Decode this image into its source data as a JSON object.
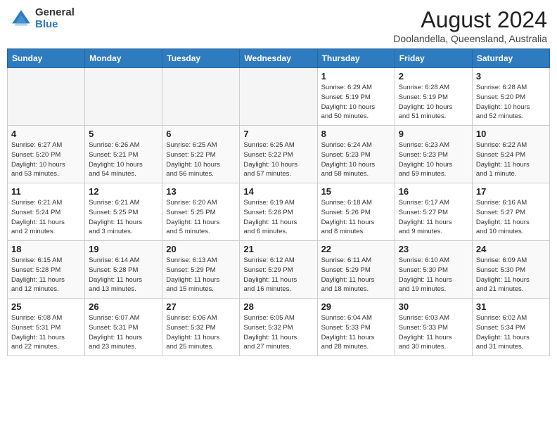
{
  "header": {
    "logo_general": "General",
    "logo_blue": "Blue",
    "month_title": "August 2024",
    "location": "Doolandella, Queensland, Australia"
  },
  "weekdays": [
    "Sunday",
    "Monday",
    "Tuesday",
    "Wednesday",
    "Thursday",
    "Friday",
    "Saturday"
  ],
  "weeks": [
    [
      {
        "day": "",
        "info": ""
      },
      {
        "day": "",
        "info": ""
      },
      {
        "day": "",
        "info": ""
      },
      {
        "day": "",
        "info": ""
      },
      {
        "day": "1",
        "info": "Sunrise: 6:29 AM\nSunset: 5:19 PM\nDaylight: 10 hours\nand 50 minutes."
      },
      {
        "day": "2",
        "info": "Sunrise: 6:28 AM\nSunset: 5:19 PM\nDaylight: 10 hours\nand 51 minutes."
      },
      {
        "day": "3",
        "info": "Sunrise: 6:28 AM\nSunset: 5:20 PM\nDaylight: 10 hours\nand 52 minutes."
      }
    ],
    [
      {
        "day": "4",
        "info": "Sunrise: 6:27 AM\nSunset: 5:20 PM\nDaylight: 10 hours\nand 53 minutes."
      },
      {
        "day": "5",
        "info": "Sunrise: 6:26 AM\nSunset: 5:21 PM\nDaylight: 10 hours\nand 54 minutes."
      },
      {
        "day": "6",
        "info": "Sunrise: 6:25 AM\nSunset: 5:22 PM\nDaylight: 10 hours\nand 56 minutes."
      },
      {
        "day": "7",
        "info": "Sunrise: 6:25 AM\nSunset: 5:22 PM\nDaylight: 10 hours\nand 57 minutes."
      },
      {
        "day": "8",
        "info": "Sunrise: 6:24 AM\nSunset: 5:23 PM\nDaylight: 10 hours\nand 58 minutes."
      },
      {
        "day": "9",
        "info": "Sunrise: 6:23 AM\nSunset: 5:23 PM\nDaylight: 10 hours\nand 59 minutes."
      },
      {
        "day": "10",
        "info": "Sunrise: 6:22 AM\nSunset: 5:24 PM\nDaylight: 11 hours\nand 1 minute."
      }
    ],
    [
      {
        "day": "11",
        "info": "Sunrise: 6:21 AM\nSunset: 5:24 PM\nDaylight: 11 hours\nand 2 minutes."
      },
      {
        "day": "12",
        "info": "Sunrise: 6:21 AM\nSunset: 5:25 PM\nDaylight: 11 hours\nand 3 minutes."
      },
      {
        "day": "13",
        "info": "Sunrise: 6:20 AM\nSunset: 5:25 PM\nDaylight: 11 hours\nand 5 minutes."
      },
      {
        "day": "14",
        "info": "Sunrise: 6:19 AM\nSunset: 5:26 PM\nDaylight: 11 hours\nand 6 minutes."
      },
      {
        "day": "15",
        "info": "Sunrise: 6:18 AM\nSunset: 5:26 PM\nDaylight: 11 hours\nand 8 minutes."
      },
      {
        "day": "16",
        "info": "Sunrise: 6:17 AM\nSunset: 5:27 PM\nDaylight: 11 hours\nand 9 minutes."
      },
      {
        "day": "17",
        "info": "Sunrise: 6:16 AM\nSunset: 5:27 PM\nDaylight: 11 hours\nand 10 minutes."
      }
    ],
    [
      {
        "day": "18",
        "info": "Sunrise: 6:15 AM\nSunset: 5:28 PM\nDaylight: 11 hours\nand 12 minutes."
      },
      {
        "day": "19",
        "info": "Sunrise: 6:14 AM\nSunset: 5:28 PM\nDaylight: 11 hours\nand 13 minutes."
      },
      {
        "day": "20",
        "info": "Sunrise: 6:13 AM\nSunset: 5:29 PM\nDaylight: 11 hours\nand 15 minutes."
      },
      {
        "day": "21",
        "info": "Sunrise: 6:12 AM\nSunset: 5:29 PM\nDaylight: 11 hours\nand 16 minutes."
      },
      {
        "day": "22",
        "info": "Sunrise: 6:11 AM\nSunset: 5:29 PM\nDaylight: 11 hours\nand 18 minutes."
      },
      {
        "day": "23",
        "info": "Sunrise: 6:10 AM\nSunset: 5:30 PM\nDaylight: 11 hours\nand 19 minutes."
      },
      {
        "day": "24",
        "info": "Sunrise: 6:09 AM\nSunset: 5:30 PM\nDaylight: 11 hours\nand 21 minutes."
      }
    ],
    [
      {
        "day": "25",
        "info": "Sunrise: 6:08 AM\nSunset: 5:31 PM\nDaylight: 11 hours\nand 22 minutes."
      },
      {
        "day": "26",
        "info": "Sunrise: 6:07 AM\nSunset: 5:31 PM\nDaylight: 11 hours\nand 23 minutes."
      },
      {
        "day": "27",
        "info": "Sunrise: 6:06 AM\nSunset: 5:32 PM\nDaylight: 11 hours\nand 25 minutes."
      },
      {
        "day": "28",
        "info": "Sunrise: 6:05 AM\nSunset: 5:32 PM\nDaylight: 11 hours\nand 27 minutes."
      },
      {
        "day": "29",
        "info": "Sunrise: 6:04 AM\nSunset: 5:33 PM\nDaylight: 11 hours\nand 28 minutes."
      },
      {
        "day": "30",
        "info": "Sunrise: 6:03 AM\nSunset: 5:33 PM\nDaylight: 11 hours\nand 30 minutes."
      },
      {
        "day": "31",
        "info": "Sunrise: 6:02 AM\nSunset: 5:34 PM\nDaylight: 11 hours\nand 31 minutes."
      }
    ]
  ]
}
